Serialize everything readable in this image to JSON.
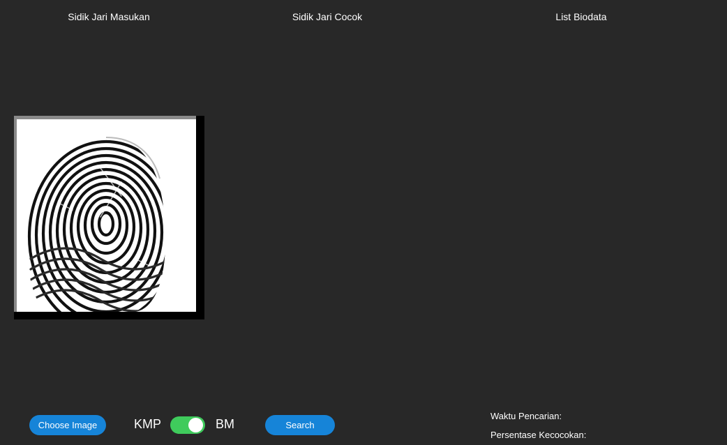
{
  "headers": {
    "input_fingerprint": "Sidik Jari Masukan",
    "matched_fingerprint": "Sidik Jari Cocok",
    "biodata_list": "List Biodata"
  },
  "input_image": {
    "icon": "fingerprint-image"
  },
  "controls": {
    "choose_image_label": "Choose Image",
    "algo_left_label": "KMP",
    "algo_right_label": "BM",
    "algo_toggle_on": true,
    "toggle_color": "#3fcb5c",
    "search_label": "Search",
    "button_color": "#1684d8"
  },
  "results": {
    "search_time_label": "Waktu Pencarian:",
    "match_percentage_label": "Persentase Kecocokan:"
  },
  "theme": {
    "background": "#282828",
    "text": "#ffffff"
  }
}
